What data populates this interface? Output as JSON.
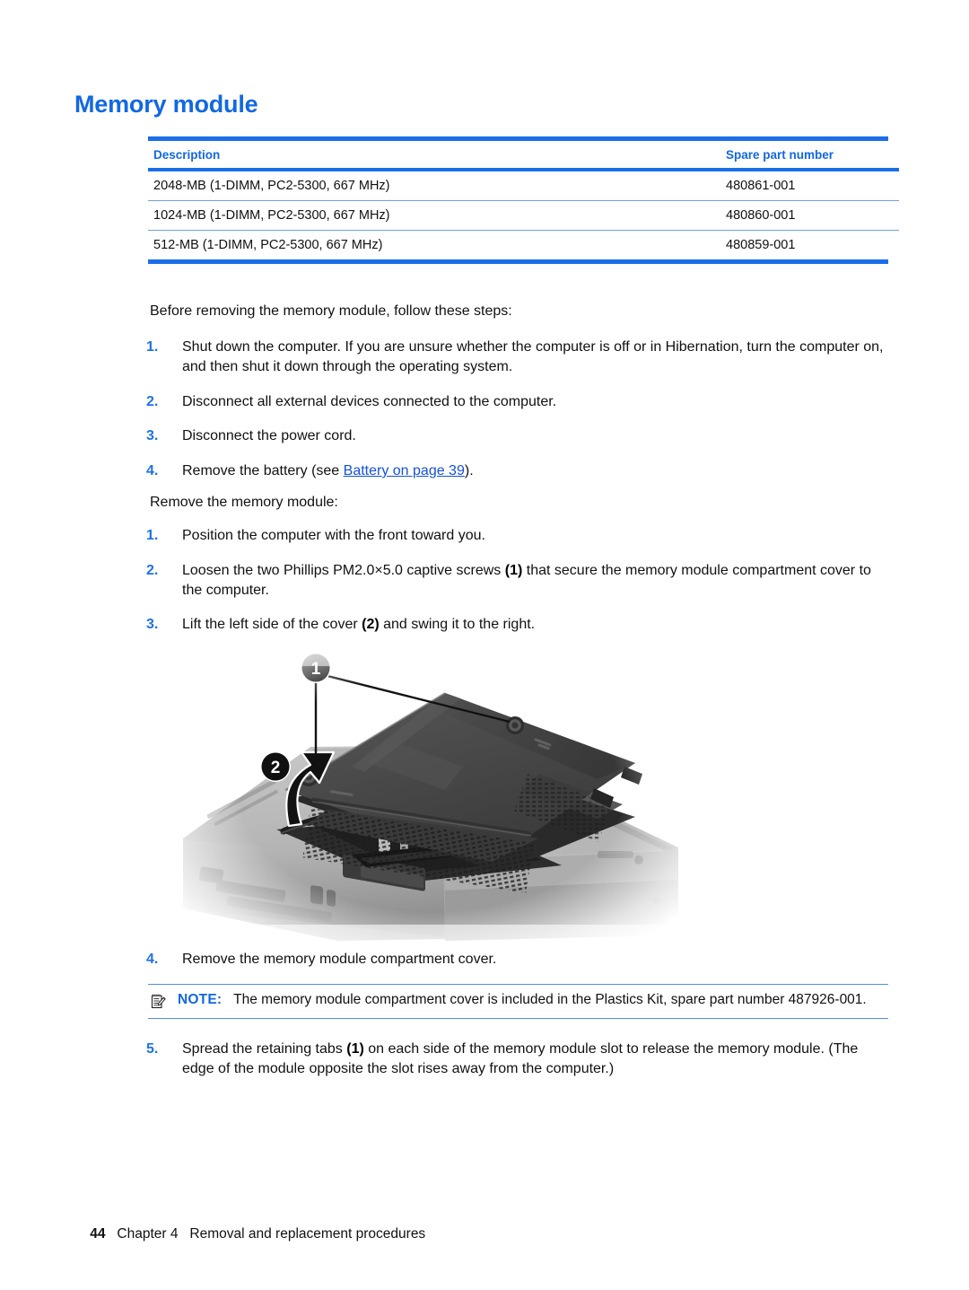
{
  "heading": "Memory module",
  "table": {
    "columns": [
      "Description",
      "Spare part number"
    ],
    "rows": [
      {
        "description": "2048-MB (1-DIMM, PC2-5300, 667 MHz)",
        "part": "480861-001"
      },
      {
        "description": "1024-MB (1-DIMM, PC2-5300, 667 MHz)",
        "part": "480860-001"
      },
      {
        "description": "512-MB (1-DIMM, PC2-5300, 667 MHz)",
        "part": "480859-001"
      }
    ]
  },
  "before_intro": "Before removing the memory module, follow these steps:",
  "before_steps": [
    {
      "num": "1.",
      "text": "Shut down the computer. If you are unsure whether the computer is off or in Hibernation, turn the computer on, and then shut it down through the operating system."
    },
    {
      "num": "2.",
      "text": "Disconnect all external devices connected to the computer."
    },
    {
      "num": "3.",
      "text": "Disconnect the power cord."
    },
    {
      "num": "4.",
      "text_before_link": "Remove the battery (see ",
      "link_text": "Battery on page 39",
      "text_after_link": ")."
    }
  ],
  "remove_intro": "Remove the memory module:",
  "remove_steps": [
    {
      "num": "1.",
      "text": "Position the computer with the front toward you."
    },
    {
      "num": "2.",
      "pre": "Loosen the two Phillips PM2.0×5.0 captive screws ",
      "callout": "(1)",
      "post": " that secure the memory module compartment cover to the computer."
    },
    {
      "num": "3.",
      "pre": "Lift the left side of the cover ",
      "callout": "(2)",
      "post": " and swing it to the right."
    }
  ],
  "figure": {
    "alt": "Laptop bottom with memory module compartment cover lifted",
    "callout_1": "1",
    "callout_2": "2"
  },
  "step_after_figure": {
    "num": "4.",
    "text": "Remove the memory module compartment cover."
  },
  "note": {
    "label": "NOTE:",
    "icon": "note-pencil-icon",
    "text": "The memory module compartment cover is included in the Plastics Kit, spare part number 487926-001."
  },
  "final_step": {
    "num": "5.",
    "pre": "Spread the retaining tabs ",
    "callout": "(1)",
    "post": " on each side of the memory module slot to release the memory module. (The edge of the module opposite the slot rises away from the computer.)"
  },
  "footer": {
    "page_number": "44",
    "chapter": "Chapter 4",
    "title": "Removal and replacement procedures"
  },
  "colors": {
    "accent_blue": "#1268e3",
    "rule_blue": "#1a6ee8",
    "row_rule": "#6ea2de",
    "link": "#1451d8"
  }
}
